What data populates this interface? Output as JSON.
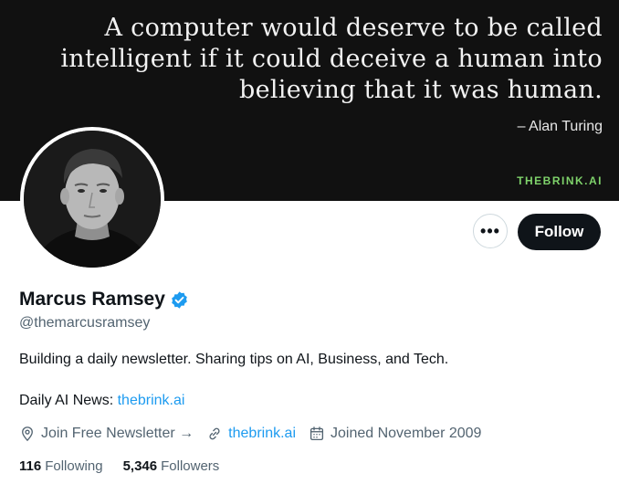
{
  "banner": {
    "quote_lines": [
      "A computer would deserve to be called",
      "intelligent if it could deceive a human into",
      "believing that it was human."
    ],
    "author": "– Alan Turing",
    "brand": "THEBRINK.AI",
    "background": "#111111",
    "brand_color": "#7fd36b"
  },
  "actions": {
    "more_label": "•••",
    "follow_label": "Follow"
  },
  "profile": {
    "name": "Marcus Ramsey",
    "handle": "@themarcusramsey",
    "bio": "Building a daily newsletter. Sharing tips on AI, Business, and Tech.",
    "news_prefix": "Daily AI News: ",
    "news_link": "thebrink.ai",
    "verified_icon": "verified-badge-icon",
    "accent": "#1d9bf0"
  },
  "meta": {
    "location_text": "Join Free Newsletter →",
    "website": "thebrink.ai",
    "joined": "Joined November 2009"
  },
  "counts": {
    "following_num": "116",
    "following_label": "Following",
    "followers_num": "5,346",
    "followers_label": "Followers"
  }
}
